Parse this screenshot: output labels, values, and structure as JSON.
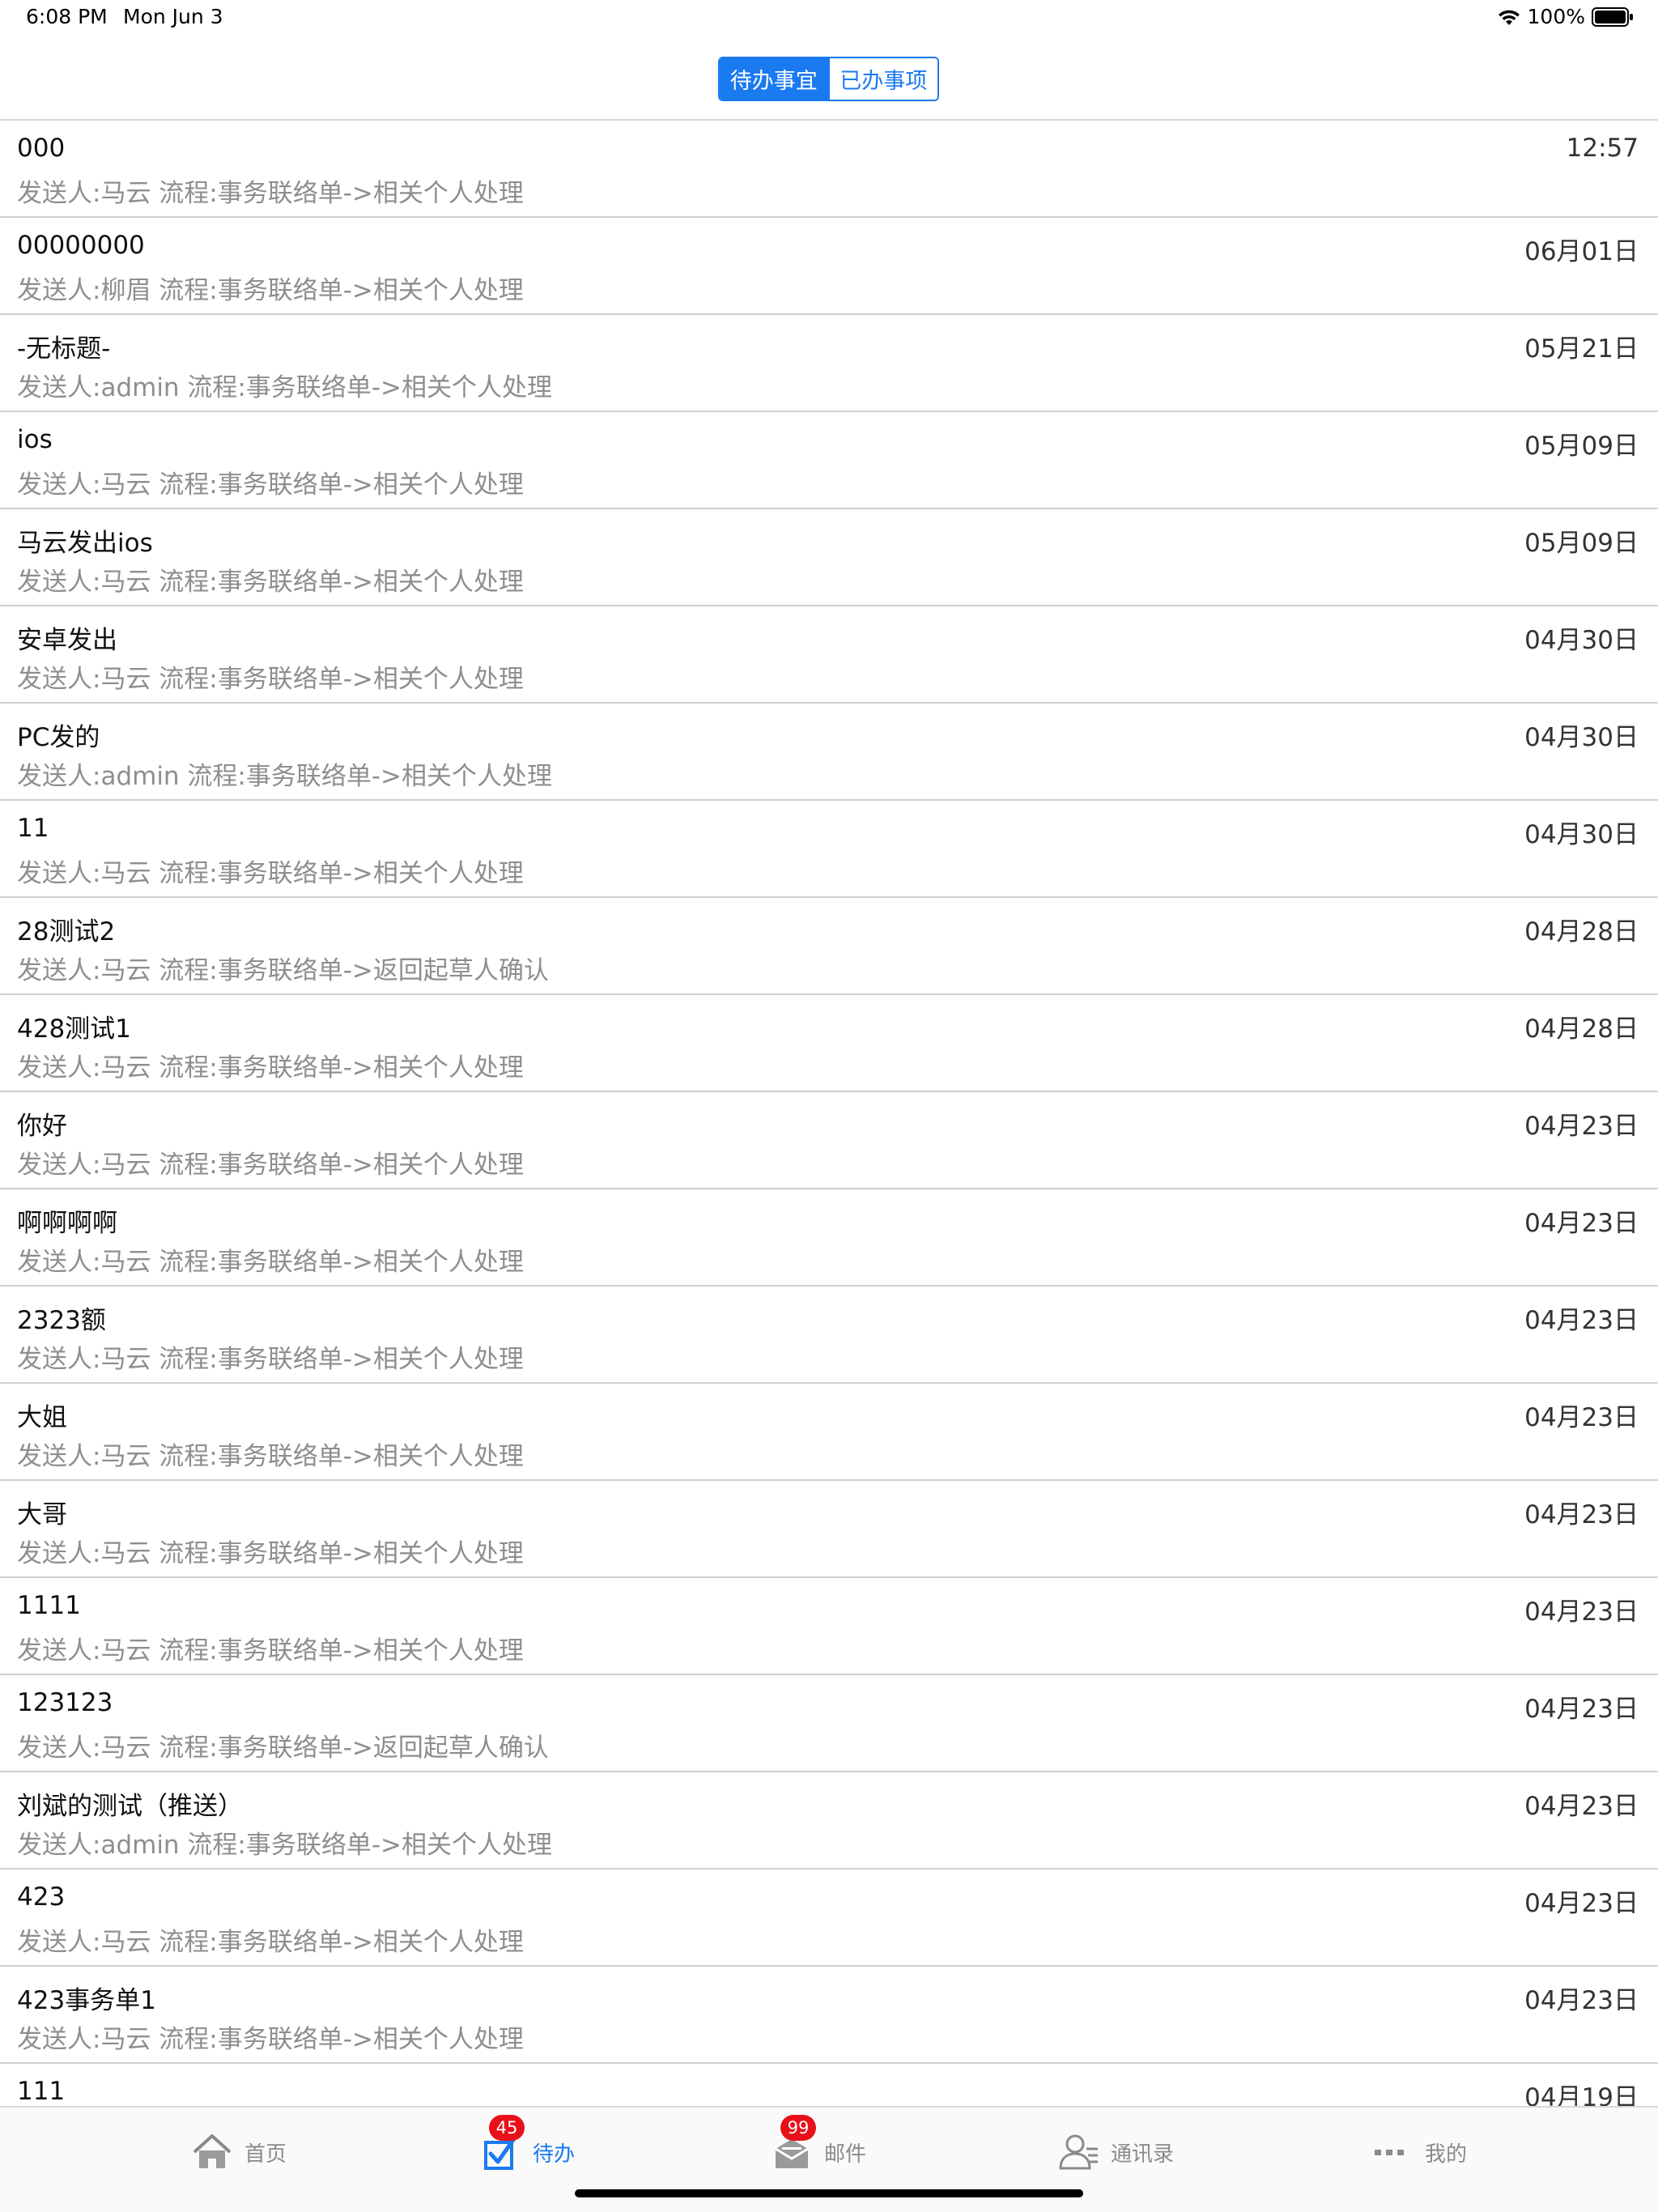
{
  "status_bar": {
    "time": "6:08 PM",
    "date": "Mon Jun 3",
    "battery": "100%"
  },
  "segments": {
    "pending": "待办事宜",
    "done": "已办事项"
  },
  "items": [
    {
      "title": "000",
      "sub": "发送人:马云 流程:事务联络单->相关个人处理",
      "date": "12:57"
    },
    {
      "title": "00000000",
      "sub": "发送人:柳眉 流程:事务联络单->相关个人处理",
      "date": "06月01日"
    },
    {
      "title": "-无标题-",
      "sub": "发送人:admin 流程:事务联络单->相关个人处理",
      "date": "05月21日"
    },
    {
      "title": "ios",
      "sub": "发送人:马云 流程:事务联络单->相关个人处理",
      "date": "05月09日"
    },
    {
      "title": "马云发出ios",
      "sub": "发送人:马云 流程:事务联络单->相关个人处理",
      "date": "05月09日"
    },
    {
      "title": "安卓发出",
      "sub": "发送人:马云 流程:事务联络单->相关个人处理",
      "date": "04月30日"
    },
    {
      "title": "PC发的",
      "sub": "发送人:admin 流程:事务联络单->相关个人处理",
      "date": "04月30日"
    },
    {
      "title": "11",
      "sub": "发送人:马云 流程:事务联络单->相关个人处理",
      "date": "04月30日"
    },
    {
      "title": "28测试2",
      "sub": "发送人:马云 流程:事务联络单->返回起草人确认",
      "date": "04月28日"
    },
    {
      "title": "428测试1",
      "sub": "发送人:马云 流程:事务联络单->相关个人处理",
      "date": "04月28日"
    },
    {
      "title": "你好",
      "sub": "发送人:马云 流程:事务联络单->相关个人处理",
      "date": "04月23日"
    },
    {
      "title": "啊啊啊啊",
      "sub": "发送人:马云 流程:事务联络单->相关个人处理",
      "date": "04月23日"
    },
    {
      "title": "2323额",
      "sub": "发送人:马云 流程:事务联络单->相关个人处理",
      "date": "04月23日"
    },
    {
      "title": "大姐",
      "sub": "发送人:马云 流程:事务联络单->相关个人处理",
      "date": "04月23日"
    },
    {
      "title": "大哥",
      "sub": "发送人:马云 流程:事务联络单->相关个人处理",
      "date": "04月23日"
    },
    {
      "title": "1111",
      "sub": "发送人:马云 流程:事务联络单->相关个人处理",
      "date": "04月23日"
    },
    {
      "title": "123123",
      "sub": "发送人:马云 流程:事务联络单->返回起草人确认",
      "date": "04月23日"
    },
    {
      "title": "刘斌的测试（推送）",
      "sub": "发送人:admin 流程:事务联络单->相关个人处理",
      "date": "04月23日"
    },
    {
      "title": "423",
      "sub": "发送人:马云 流程:事务联络单->相关个人处理",
      "date": "04月23日"
    },
    {
      "title": "423事务单1",
      "sub": "发送人:马云 流程:事务联络单->相关个人处理",
      "date": "04月23日"
    },
    {
      "title": "111",
      "sub": "",
      "date": "04月19日"
    }
  ],
  "tabs": {
    "home": "首页",
    "todo": "待办",
    "todo_badge": "45",
    "mail": "邮件",
    "mail_badge": "99",
    "contacts": "通讯录",
    "mine": "我的"
  },
  "icons": [
    "wifi-icon",
    "battery-icon",
    "home-icon",
    "checkbox-icon",
    "mail-icon",
    "contacts-icon",
    "more-icon"
  ],
  "colors": {
    "accent": "#1a7af0",
    "badge": "#e8101a",
    "secondary_text": "#8e8e8e"
  }
}
